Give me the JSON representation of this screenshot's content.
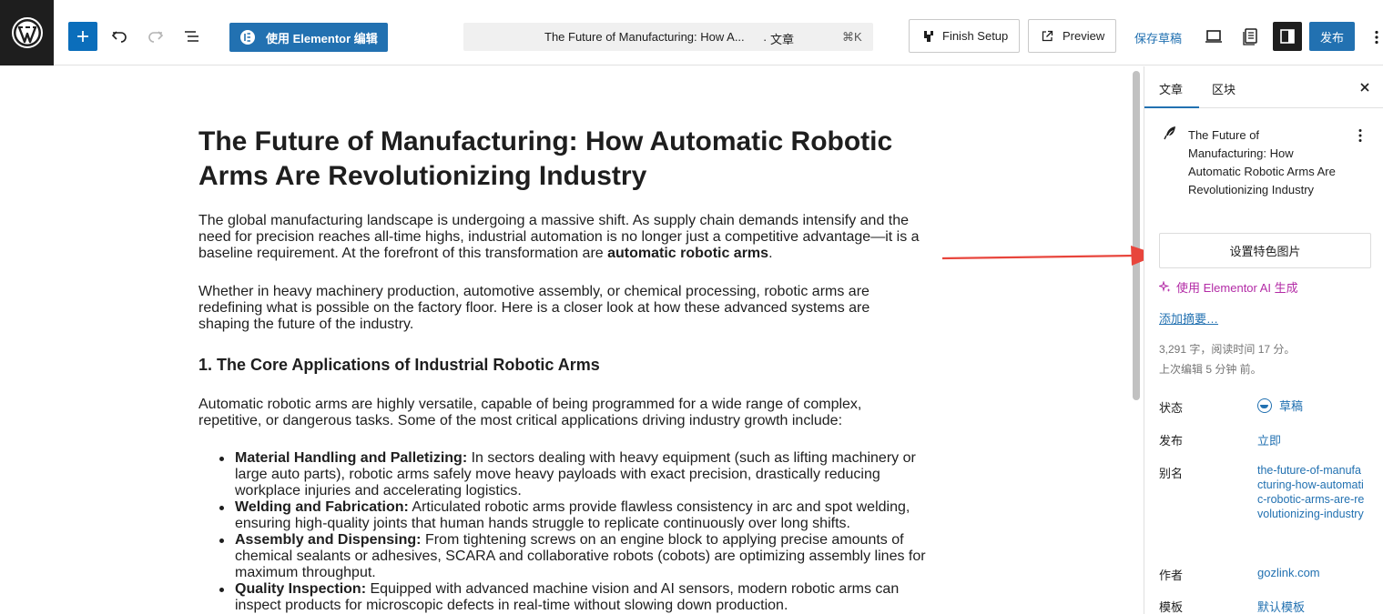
{
  "toolbar": {
    "elementor_label": "使用 Elementor 编辑",
    "doc_title": "The Future of Manufacturing: How A...",
    "doc_type": "· 文章",
    "doc_shortcut": "⌘K",
    "finish_setup": "Finish Setup",
    "preview": "Preview",
    "save_draft": "保存草稿",
    "publish": "发布"
  },
  "post": {
    "title": "The Future of Manufacturing: How Automatic Robotic Arms Are Revolutionizing Industry",
    "p1_a": "The global manufacturing landscape is undergoing a massive shift. As supply chain demands intensify and the need for precision reaches all-time highs, industrial automation is no longer just a competitive advantage—it is a baseline requirement. At the forefront of this transformation are ",
    "p1_bold": "automatic robotic arms",
    "p1_end": ".",
    "p2": "Whether in heavy machinery production, automotive assembly, or chemical processing, robotic arms are redefining what is possible on the factory floor. Here is a closer look at how these advanced systems are shaping the future of the industry.",
    "h3": "1. The Core Applications of Industrial Robotic Arms",
    "p3": "Automatic robotic arms are highly versatile, capable of being programmed for a wide range of complex, repetitive, or dangerous tasks. Some of the most critical applications driving industry growth include:",
    "list": [
      {
        "bold": "Material Handling and Palletizing:",
        "text": " In sectors dealing with heavy equipment (such as lifting machinery or large auto parts), robotic arms safely move heavy payloads with exact precision, drastically reducing workplace injuries and accelerating logistics."
      },
      {
        "bold": "Welding and Fabrication:",
        "text": " Articulated robotic arms provide flawless consistency in arc and spot welding, ensuring high-quality joints that human hands struggle to replicate continuously over long shifts."
      },
      {
        "bold": "Assembly and Dispensing:",
        "text": " From tightening screws on an engine block to applying precise amounts of chemical sealants or adhesives, SCARA and collaborative robots (cobots) are optimizing assembly lines for maximum throughput."
      },
      {
        "bold": "Quality Inspection:",
        "text": " Equipped with advanced machine vision and AI sensors, modern robotic arms can inspect products for microscopic defects in real-time without slowing down production."
      }
    ]
  },
  "sidebar": {
    "tab_post": "文章",
    "tab_block": "区块",
    "card_title": "The Future of Manufacturing: How Automatic Robotic Arms Are Revolutionizing Industry",
    "featured_image": "设置特色图片",
    "ai_generate": "使用 Elementor AI 生成",
    "add_excerpt": "添加摘要…",
    "word_count": "3,291 字，阅读时间 17 分。",
    "last_edited": "上次编辑 5 分钟 前。",
    "fields": {
      "status_label": "状态",
      "status_value": "草稿",
      "publish_label": "发布",
      "publish_value": "立即",
      "slug_label": "别名",
      "slug_value": "the-future-of-manufacturing-how-automatic-robotic-arms-are-revolutionizing-industry",
      "author_label": "作者",
      "author_value": "gozlink.com",
      "template_label": "模板",
      "template_value": "默认模板"
    }
  },
  "colors": {
    "accent": "#2271b1",
    "ai_purple": "#b32ba6",
    "annotation_red": "#e8453c"
  }
}
